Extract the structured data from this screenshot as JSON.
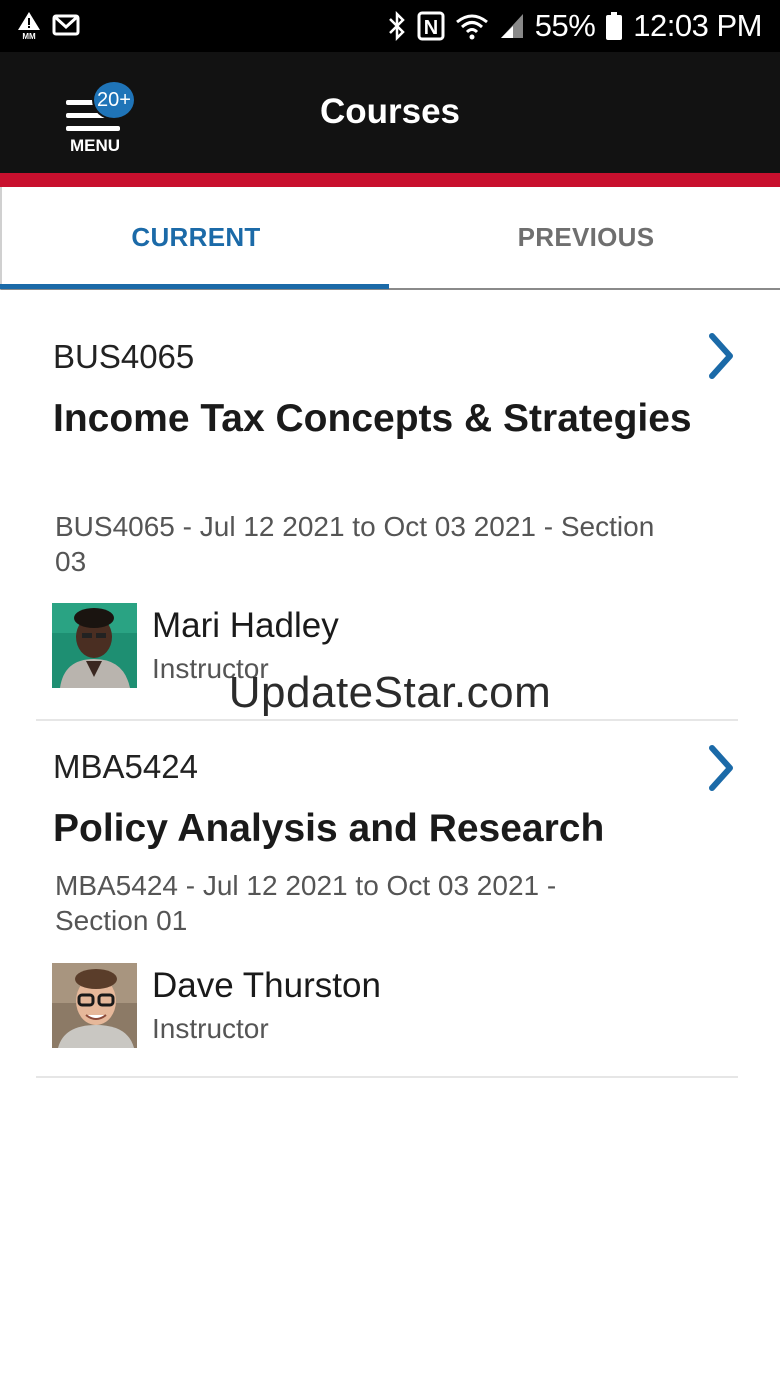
{
  "status_bar": {
    "left_icons": [
      "warning-triangle-icon",
      "gmail-icon"
    ],
    "right_icons": [
      "bluetooth-icon",
      "nfc-icon",
      "wifi-icon",
      "signal-icon",
      "battery-icon"
    ],
    "battery": "55%",
    "time": "12:03 PM"
  },
  "header": {
    "title": "Courses",
    "menu_label": "MENU",
    "badge": "20+"
  },
  "colors": {
    "header_bg": "#121212",
    "accent_red": "#c8102e",
    "primary_blue": "#1b6aa8",
    "badge_blue": "#1f74b8"
  },
  "tabs": [
    {
      "label": "CURRENT",
      "active": true
    },
    {
      "label": "PREVIOUS",
      "active": false
    }
  ],
  "courses": [
    {
      "code": "BUS4065",
      "title": "Income Tax Concepts & Strategies",
      "meta": "BUS4065 - Jul 12 2021 to Oct 03 2021 - Section 03",
      "instructor": {
        "name": "Mari Hadley",
        "role": "Instructor"
      }
    },
    {
      "code": "MBA5424",
      "title": "Policy Analysis and Research",
      "meta": "MBA5424 - Jul 12 2021 to Oct 03 2021 - Section 01",
      "instructor": {
        "name": "Dave Thurston",
        "role": "Instructor"
      }
    }
  ],
  "watermark": "UpdateStar.com"
}
